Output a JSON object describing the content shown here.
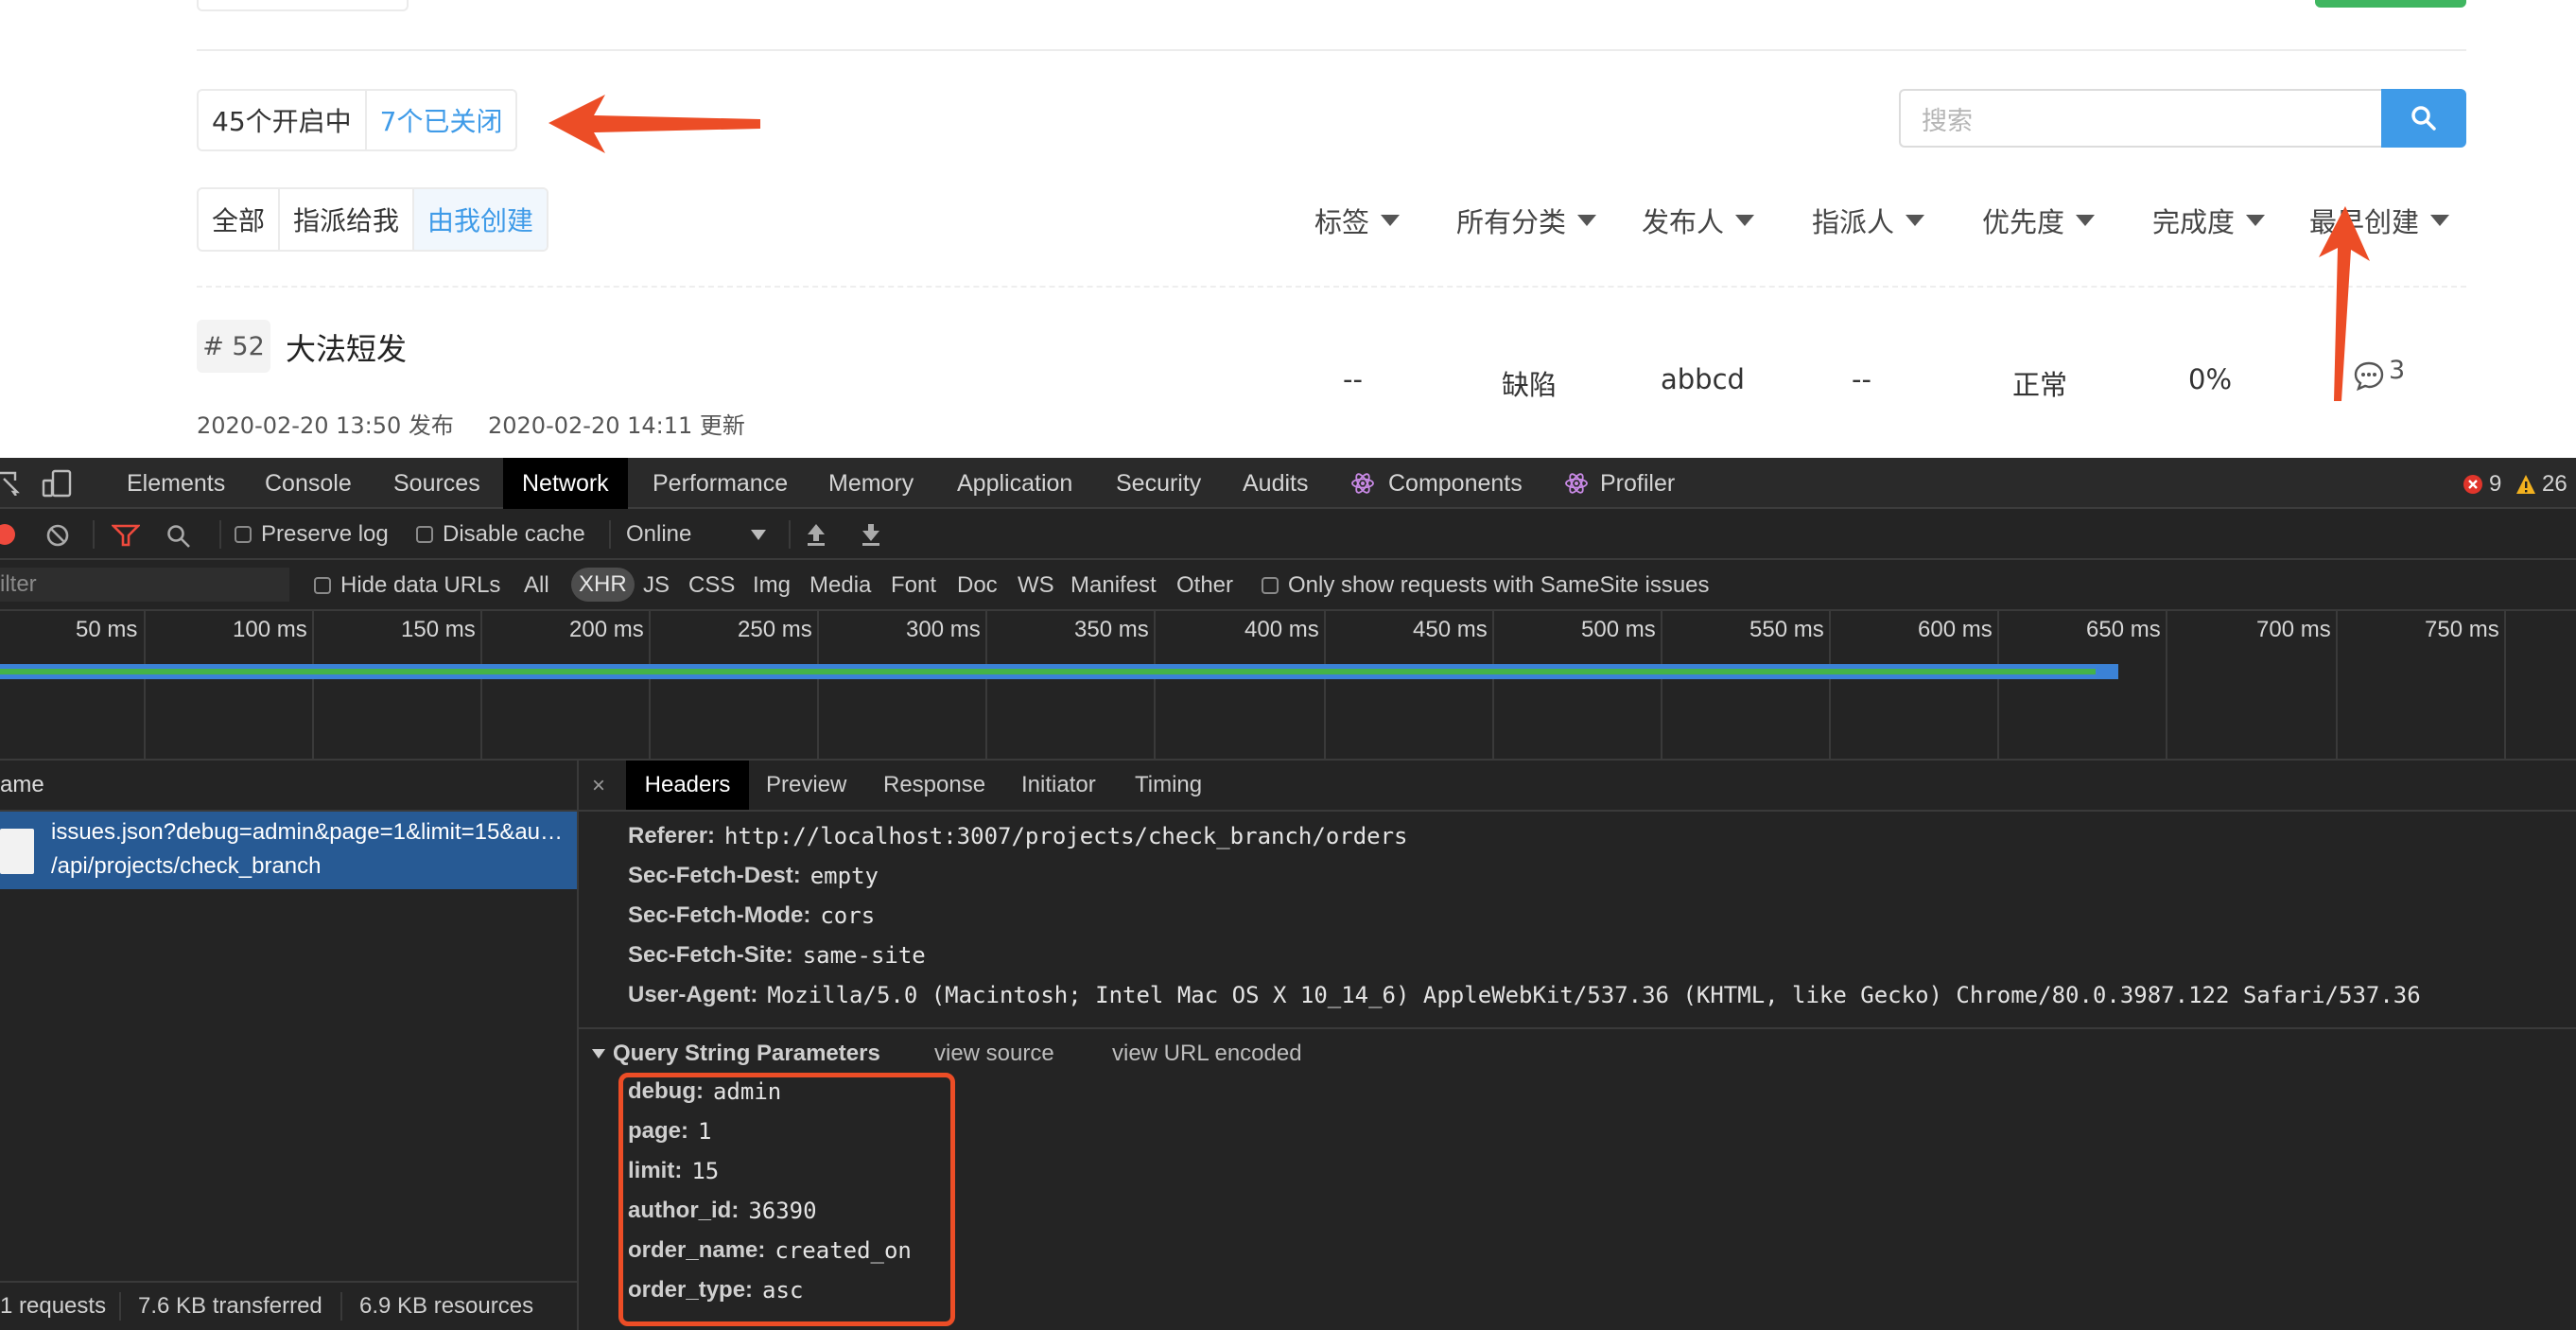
{
  "issues": {
    "status_tabs": [
      "45个开启中",
      "7个已关闭"
    ],
    "scope_tabs": [
      "全部",
      "指派给我",
      "由我创建"
    ],
    "search": {
      "placeholder": "搜索"
    },
    "filters": [
      "标签",
      "所有分类",
      "发布人",
      "指派人",
      "优先度",
      "完成度",
      "最早创建"
    ],
    "issue": {
      "number": "# 52",
      "title": "大法短发",
      "published": "2020-02-20 13:50 发布",
      "updated": "2020-02-20 14:11 更新",
      "tag": "--",
      "category": "缺陷",
      "author": "abbcd",
      "assignee": "--",
      "priority": "正常",
      "progress": "0%",
      "comments": "3"
    },
    "colors": {
      "accent": "#3f9be8",
      "arrow": "#ec4d26",
      "annotation_box": "#ec4d26"
    }
  },
  "devtools": {
    "tabs": [
      "Elements",
      "Console",
      "Sources",
      "Network",
      "Performance",
      "Memory",
      "Application",
      "Security",
      "Audits",
      "Components",
      "Profiler"
    ],
    "active_tab": "Network",
    "errors": "9",
    "warnings": "26",
    "toolbar": {
      "preserve_log": "Preserve log",
      "disable_cache": "Disable cache",
      "throttle": "Online"
    },
    "filter_bar": {
      "filter_placeholder": "ilter",
      "hide_data_urls": "Hide data URLs",
      "types": [
        "All",
        "XHR",
        "JS",
        "CSS",
        "Img",
        "Media",
        "Font",
        "Doc",
        "WS",
        "Manifest",
        "Other"
      ],
      "active_type": "XHR",
      "samesite": "Only show requests with SameSite issues"
    },
    "timeline_ticks": [
      "50 ms",
      "100 ms",
      "150 ms",
      "200 ms",
      "250 ms",
      "300 ms",
      "350 ms",
      "400 ms",
      "450 ms",
      "500 ms",
      "550 ms",
      "600 ms",
      "650 ms",
      "700 ms",
      "750 ms"
    ],
    "name_header": "ame",
    "request": {
      "line1": "issues.json?debug=admin&page=1&limit=15&au…",
      "line2": "/api/projects/check_branch"
    },
    "detail_tabs": [
      "Headers",
      "Preview",
      "Response",
      "Initiator",
      "Timing"
    ],
    "active_detail_tab": "Headers",
    "headers": [
      {
        "key": "Referer:",
        "value": "http://localhost:3007/projects/check_branch/orders"
      },
      {
        "key": "Sec-Fetch-Dest:",
        "value": "empty"
      },
      {
        "key": "Sec-Fetch-Mode:",
        "value": "cors"
      },
      {
        "key": "Sec-Fetch-Site:",
        "value": "same-site"
      },
      {
        "key": "User-Agent:",
        "value": "Mozilla/5.0 (Macintosh; Intel Mac OS X 10_14_6) AppleWebKit/537.36 (KHTML, like Gecko) Chrome/80.0.3987.122 Safari/537.36"
      }
    ],
    "query_section": {
      "title": "Query String Parameters",
      "view_source": "view source",
      "view_url_encoded": "view URL encoded"
    },
    "query_params": [
      {
        "key": "debug:",
        "value": "admin"
      },
      {
        "key": "page:",
        "value": "1"
      },
      {
        "key": "limit:",
        "value": "15"
      },
      {
        "key": "author_id:",
        "value": "36390"
      },
      {
        "key": "order_name:",
        "value": "created_on"
      },
      {
        "key": "order_type:",
        "value": "asc"
      }
    ],
    "status_bar": [
      "1 requests",
      "7.6 KB transferred",
      "6.9 KB resources"
    ]
  }
}
